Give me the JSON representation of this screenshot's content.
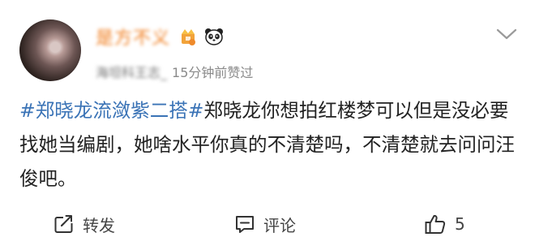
{
  "post": {
    "author": {
      "username": "是方不义",
      "source_user": "海坦科王志_",
      "timestamp": "15分钟前赞过"
    },
    "content": {
      "topic1": "#郑晓龙流潋紫二搭#",
      "text": "郑晓龙你想拍红楼梦可以但是没必要找她当编剧，她啥水平你真的不清楚吗，不清楚就去问问汪俊吧。"
    }
  },
  "actions": {
    "repost_label": "转发",
    "comment_label": "评论",
    "like_count": "5"
  },
  "icons": {
    "more": "chevron-down-icon",
    "repost": "repost-icon",
    "comment": "comment-icon",
    "like": "thumbs-up-icon",
    "crown_badge": "crown-badge-icon",
    "panda_badge": "panda-badge-icon"
  },
  "colors": {
    "topic": "#3a73b6",
    "username": "#f07b1a",
    "meta": "#8a8a8a"
  }
}
